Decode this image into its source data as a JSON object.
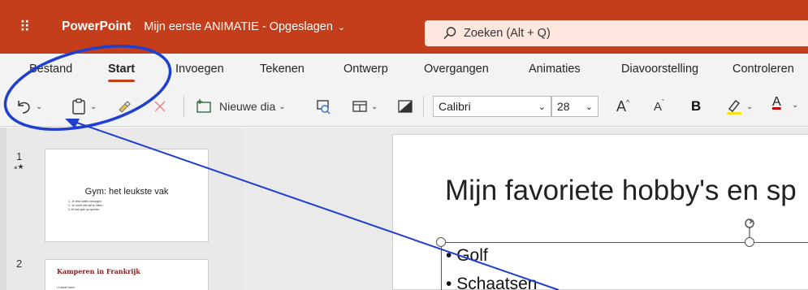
{
  "titlebar": {
    "app_name": "PowerPoint",
    "document_name": "Mijn eerste ANIMATIE - Opgeslagen",
    "search_placeholder": "Zoeken (Alt + Q)",
    "accent_color": "#c43e1c",
    "search_bg": "#fde7df"
  },
  "tabs": [
    {
      "label": "Bestand"
    },
    {
      "label": "Start",
      "active": true
    },
    {
      "label": "Invoegen"
    },
    {
      "label": "Tekenen"
    },
    {
      "label": "Ontwerp"
    },
    {
      "label": "Overgangen"
    },
    {
      "label": "Animaties"
    },
    {
      "label": "Diavoorstelling"
    },
    {
      "label": "Controleren"
    }
  ],
  "ribbon": {
    "new_slide_label": "Nieuwe dia",
    "font_name": "Calibri",
    "font_size": "28",
    "bold_label": "B",
    "grow_font_label": "A",
    "shrink_font_label": "A",
    "font_color_label": "A",
    "icons": [
      "undo-icon",
      "paste-icon",
      "format-painter-icon",
      "delete-icon",
      "new-slide-icon",
      "reuse-slides-icon",
      "layout-icon",
      "shape-fill-icon",
      "highlighter-icon",
      "font-color-icon"
    ]
  },
  "slides": [
    {
      "number": "1",
      "star": "⁎★",
      "title": "Gym: het leukste vak",
      "bullets": [
        "1.  Je leert tellen bewegen",
        "2.  Je hoeft niet stil te zitten",
        "3.  Al kan gek op sporten"
      ]
    },
    {
      "number": "2",
      "title": "Kamperen in Frankrijk",
      "line": "• Lekker weer"
    }
  ],
  "current_slide": {
    "title": "Mijn favoriete hobby's en sp",
    "bullets": [
      "Golf",
      "Schaatsen"
    ]
  },
  "annotation": {
    "color": "#1f3fd1"
  }
}
